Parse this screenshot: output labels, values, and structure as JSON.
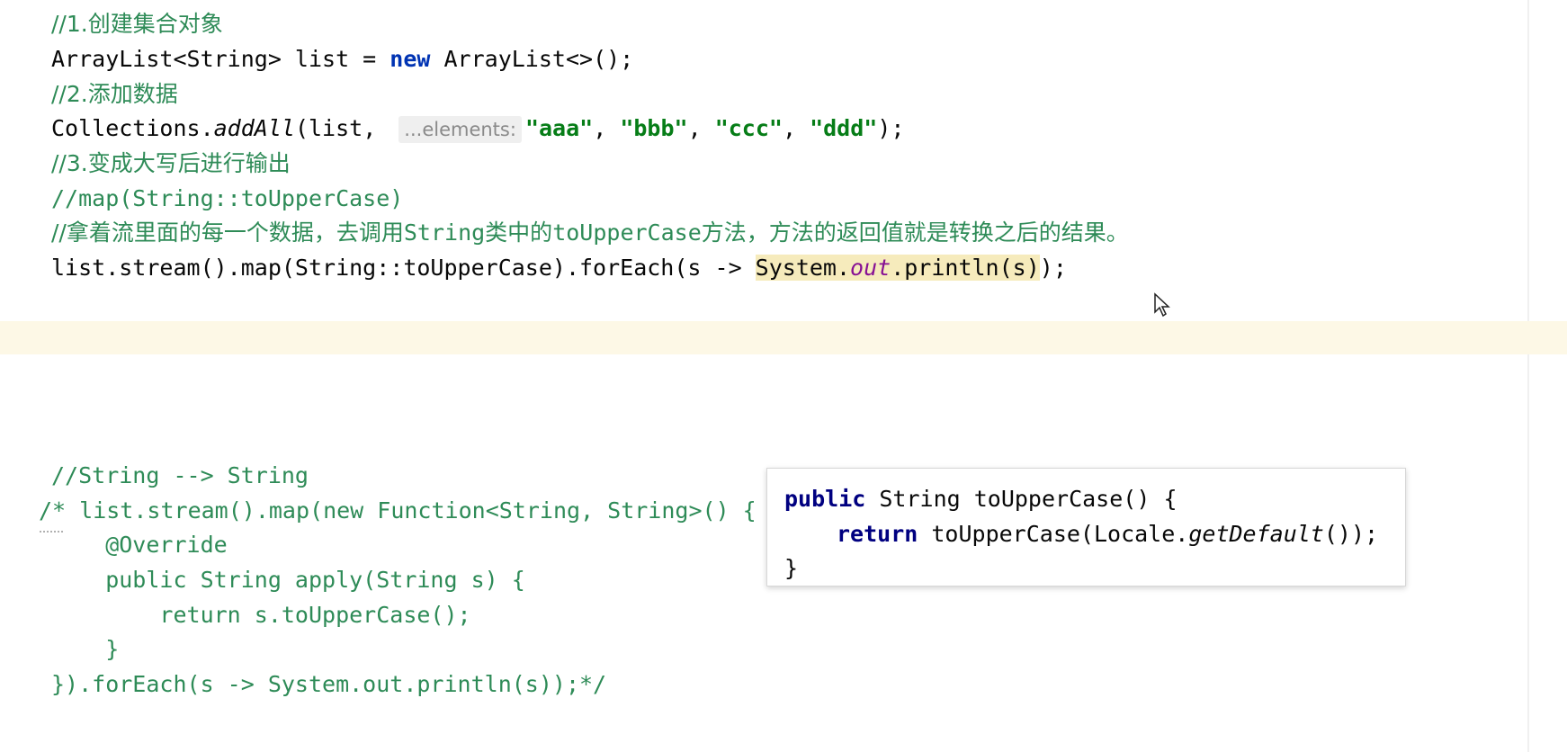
{
  "code": {
    "comment1": "//1.创建集合对象",
    "l2_type": "ArrayList<String> list = ",
    "l2_new": "new",
    "l2_rest": " ArrayList<>();",
    "comment2": "//2.添加数据",
    "l4_obj": "Collections.",
    "l4_method": "addAll",
    "l4_args": "(list, ",
    "l4_hint": "...elements:",
    "l4_s1": "\"aaa\"",
    "l4_sep1": ", ",
    "l4_s2": "\"bbb\"",
    "l4_sep2": ", ",
    "l4_s3": "\"ccc\"",
    "l4_sep3": ", ",
    "l4_s4": "\"ddd\"",
    "l4_end": ");",
    "comment3": "//3.变成大写后进行输出",
    "comment4": "//map(String::toUpperCase)",
    "comment5_a": "//拿着流里面的每一个数据，去调用",
    "comment5_b": "String",
    "comment5_c": "类中的",
    "comment5_d": "toUpperCase",
    "comment5_e": "方法，方法的返回值就是转换之后的结果。",
    "l9_a": "list.stream().map(String::toUpperCase).forEach(s -> ",
    "l9_sys": "System.",
    "l9_out": "out",
    "l9_println": ".println(s)",
    "l9_end": ");",
    "comment6": "//String --> String",
    "block1": "/* list.stream().map(new Function<String, String>() {",
    "block2": "    @Override",
    "block3": "    public String apply(String s) {",
    "block4": "        return s.toUpperCase();",
    "block5": "    }",
    "block6": "}).forEach(s -> System.out.println(s));*/"
  },
  "doc_popup": {
    "line1_kw": "public",
    "line1_rest": " String toUpperCase() {",
    "line2_kw": "return",
    "line2_a": " toUpperCase(Locale.",
    "line2_it": "getDefault",
    "line2_b": "());",
    "line3": "}"
  },
  "icons": {
    "cursor": "mouse-pointer-icon"
  },
  "colors": {
    "comment": "#2e8b57",
    "keyword": "#0033b3",
    "string": "#067d17",
    "field": "#871094",
    "caret_line": "#fdf8e6",
    "highlight": "#f6ebbc"
  }
}
